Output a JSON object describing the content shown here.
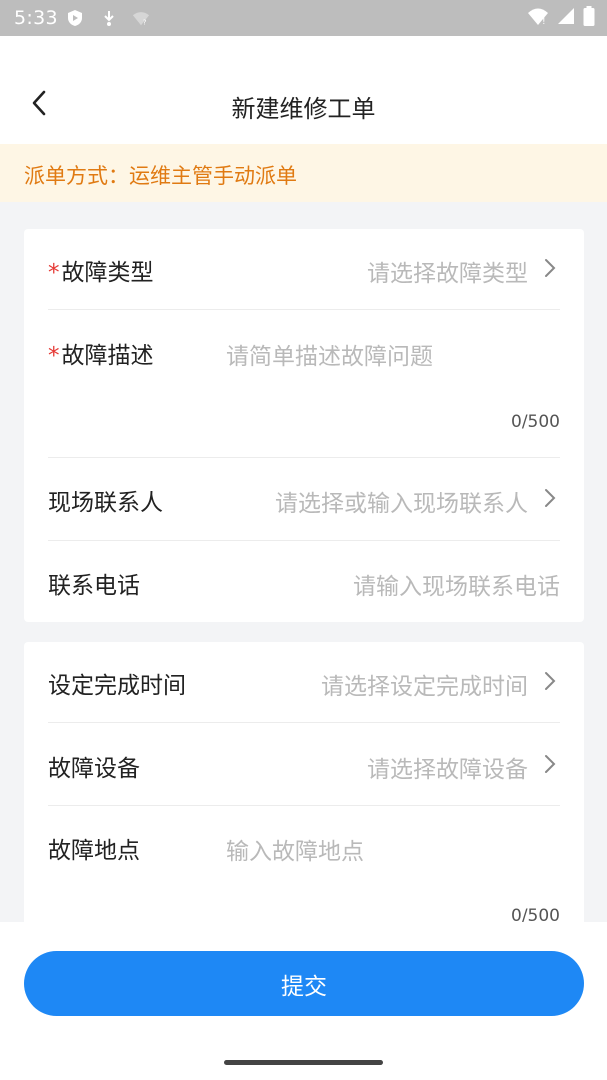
{
  "status_bar": {
    "time": "5:33",
    "left_icons": [
      "play-protect-icon",
      "download-icon",
      "wifi-question-icon"
    ],
    "right_icons": [
      "wifi-icon",
      "signal-icon",
      "battery-icon"
    ]
  },
  "header": {
    "title": "新建维修工单",
    "back_icon": "chevron-left-icon"
  },
  "notice": {
    "text": "派单方式：运维主管手动派单",
    "color": "#e07a12",
    "background": "#fef6e5"
  },
  "form": {
    "section1": {
      "fault_type": {
        "required": true,
        "label": "故障类型",
        "placeholder": "请选择故障类型"
      },
      "fault_desc": {
        "required": true,
        "label": "故障描述",
        "placeholder": "请简单描述故障问题",
        "counter": "0/500"
      },
      "contact_person": {
        "label": "现场联系人",
        "placeholder": "请选择或输入现场联系人"
      },
      "contact_phone": {
        "label": "联系电话",
        "placeholder": "请输入现场联系电话"
      }
    },
    "section2": {
      "finish_time": {
        "label": "设定完成时间",
        "placeholder": "请选择设定完成时间"
      },
      "fault_device": {
        "label": "故障设备",
        "placeholder": "请选择故障设备"
      },
      "fault_location": {
        "label": "故障地点",
        "placeholder": "输入故障地点",
        "counter": "0/500"
      }
    }
  },
  "required_mark": "*",
  "submit": {
    "label": "提交",
    "color": "#1e88f5"
  }
}
